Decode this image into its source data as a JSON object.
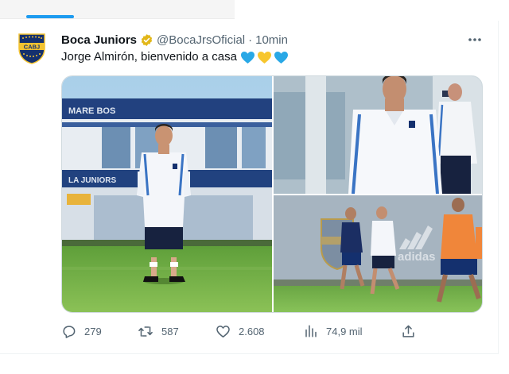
{
  "tweet": {
    "author_name": "Boca Juniors",
    "handle": "@BocaJrsOficial",
    "separator": "·",
    "time": "10min",
    "text": "Jorge Almirón, bienvenido a casa",
    "emoji": [
      "blue-heart",
      "yellow-heart",
      "blue-heart"
    ],
    "avatar_text": "CABJ",
    "more_icon": "more-dots-icon"
  },
  "media": {
    "photos": [
      {
        "description_icon": "photo"
      },
      {
        "description_icon": "photo"
      },
      {
        "description_icon": "photo"
      }
    ],
    "sign_text_1": "MARE BOS",
    "sign_text_2": "LA JUNIORS",
    "adidas_text": "adidas"
  },
  "actions": {
    "replies": "279",
    "retweets": "587",
    "likes": "2.608",
    "views": "74,9 mil"
  },
  "colors": {
    "accent": "#1d9bf0",
    "boca_blue": "#14306e",
    "boca_gold": "#f2c230",
    "muted_text": "#536471"
  }
}
